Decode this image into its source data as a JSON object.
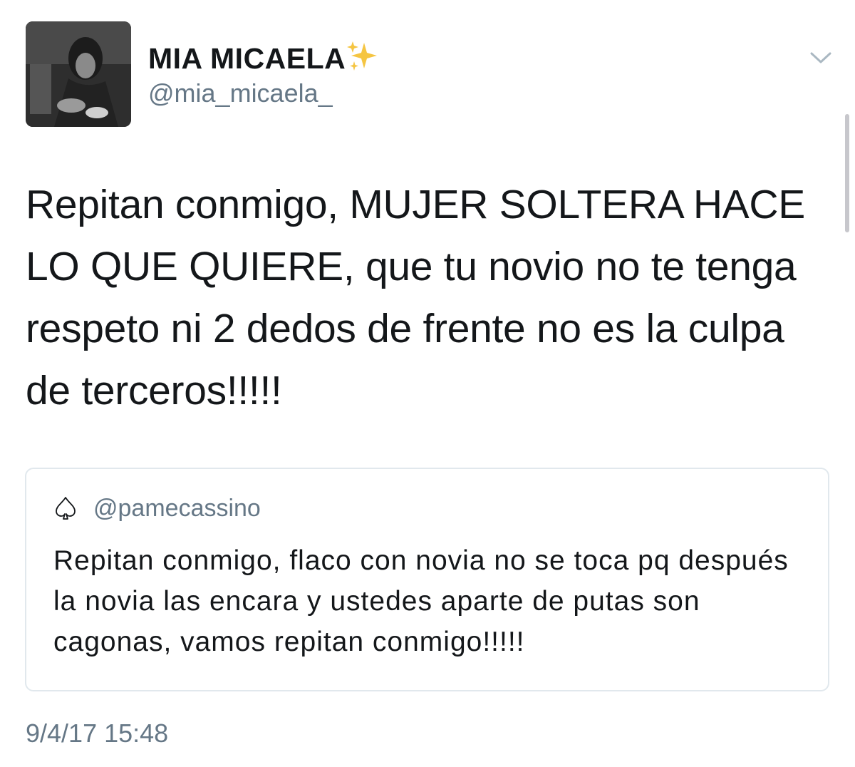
{
  "author": {
    "display_name": "MIA MICAELA",
    "handle": "@mia_micaela_",
    "avatar_icon": "profile-photo"
  },
  "tweet": {
    "text": "Repitan conmigo, MUJER SOLTERA HACE LO QUE QUIERE, que tu novio no te tenga respeto ni 2 dedos de frente no es la culpa de terceros!!!!!",
    "timestamp": "9/4/17 15:48"
  },
  "quoted_tweet": {
    "icon": "spade-icon",
    "handle": "@pamecassino",
    "text": "Repitan conmigo, flaco con novia no se toca pq después la novia las encara y ustedes aparte de putas son cagonas, vamos repitan conmigo!!!!!"
  },
  "colors": {
    "text_primary": "#14171a",
    "text_secondary": "#657786",
    "border": "#e1e8ed",
    "sparkle": "#f5c542"
  }
}
